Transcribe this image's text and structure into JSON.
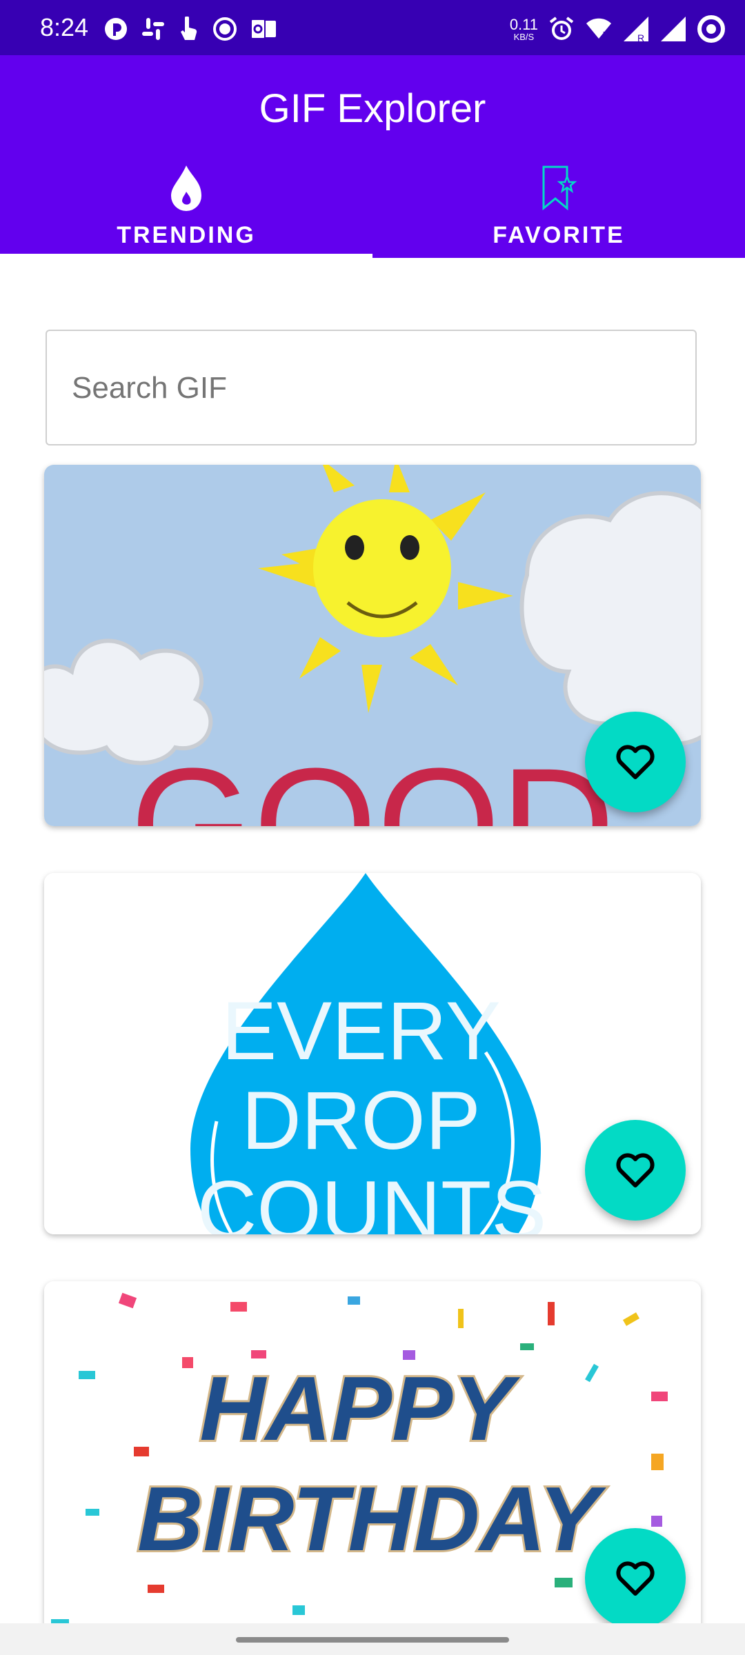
{
  "status_bar": {
    "time": "8:24",
    "net_speed_value": "0.11",
    "net_speed_unit": "KB/S",
    "left_icons": [
      "messenger-icon",
      "slack-icon",
      "touch-icon",
      "record-icon",
      "outlook-icon"
    ],
    "right_icons": [
      "alarm-icon",
      "wifi-icon",
      "signal-r-icon",
      "signal-icon",
      "battery-ring-icon"
    ]
  },
  "app_bar": {
    "title": "GIF Explorer",
    "tabs": [
      {
        "label": "TRENDING",
        "icon": "fire-icon",
        "selected": true
      },
      {
        "label": "FAVORITE",
        "icon": "bookmark-star-icon",
        "selected": false
      }
    ]
  },
  "search": {
    "placeholder": "Search GIF",
    "value": ""
  },
  "gifs": [
    {
      "caption_text": "GOOD",
      "icon": "heart-outline-icon"
    },
    {
      "caption_text": "EVERY DROP COUNTS",
      "icon": "heart-outline-icon"
    },
    {
      "caption_text": "HAPPY BIRTHDAY",
      "icon": "heart-outline-icon"
    }
  ],
  "colors": {
    "status_bar": "#3700b3",
    "primary": "#6200ee",
    "fab": "#03dac5",
    "favorite_icon": "#03dac5",
    "water_drop": "#00aeef",
    "good_text": "#c8274a"
  }
}
